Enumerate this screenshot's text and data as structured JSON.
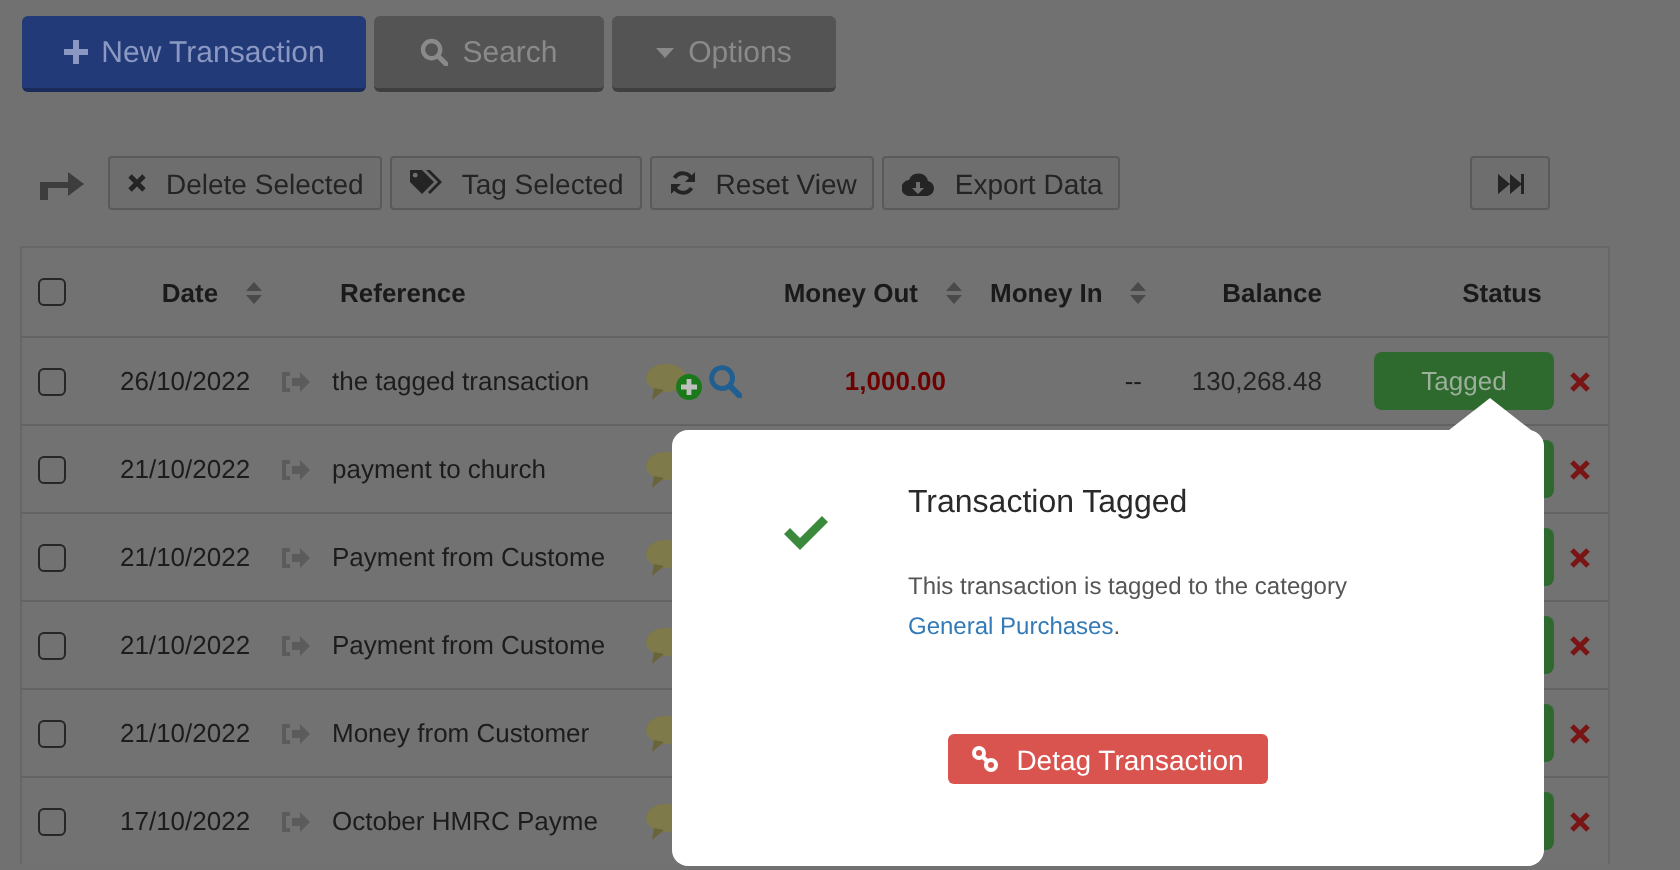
{
  "top_buttons": [
    {
      "kind": "primary",
      "label": "New Transaction"
    },
    {
      "kind": "default",
      "label": "Search"
    },
    {
      "kind": "default",
      "label": "Options"
    }
  ],
  "toolbar": [
    {
      "label": "Delete Selected"
    },
    {
      "label": "Tag Selected"
    },
    {
      "label": "Reset View"
    },
    {
      "label": "Export Data"
    }
  ],
  "table": {
    "select_all_checked": false,
    "columns": [
      {
        "label": "Date",
        "sortable": true
      },
      {
        "label": "Reference",
        "sortable": false
      },
      {
        "label": "Money Out",
        "sortable": true
      },
      {
        "label": "Money In",
        "sortable": true
      },
      {
        "label": "Balance",
        "sortable": false
      },
      {
        "label": "Status",
        "sortable": false
      }
    ],
    "rows": [
      {
        "checked": false,
        "date": "26/10/2022",
        "reference": "the tagged transaction",
        "kind": "with_actions",
        "money_out": "1,000.00",
        "money_in": "--",
        "balance": "130,268.48",
        "status": "Tagged"
      },
      {
        "checked": false,
        "date": "21/10/2022",
        "reference": "payment to church"
      },
      {
        "checked": false,
        "date": "21/10/2022",
        "reference": "Payment from Custome"
      },
      {
        "checked": false,
        "date": "21/10/2022",
        "reference": "Payment from Custome"
      },
      {
        "checked": false,
        "date": "21/10/2022",
        "reference": "Money from Customer"
      },
      {
        "checked": false,
        "date": "17/10/2022",
        "reference": "October HMRC Payme"
      }
    ]
  },
  "popup": {
    "title": "Transaction Tagged",
    "message": "This transaction is tagged to the category ",
    "link": "General Purchases",
    "message_end": ".",
    "button": "Detag Transaction"
  }
}
